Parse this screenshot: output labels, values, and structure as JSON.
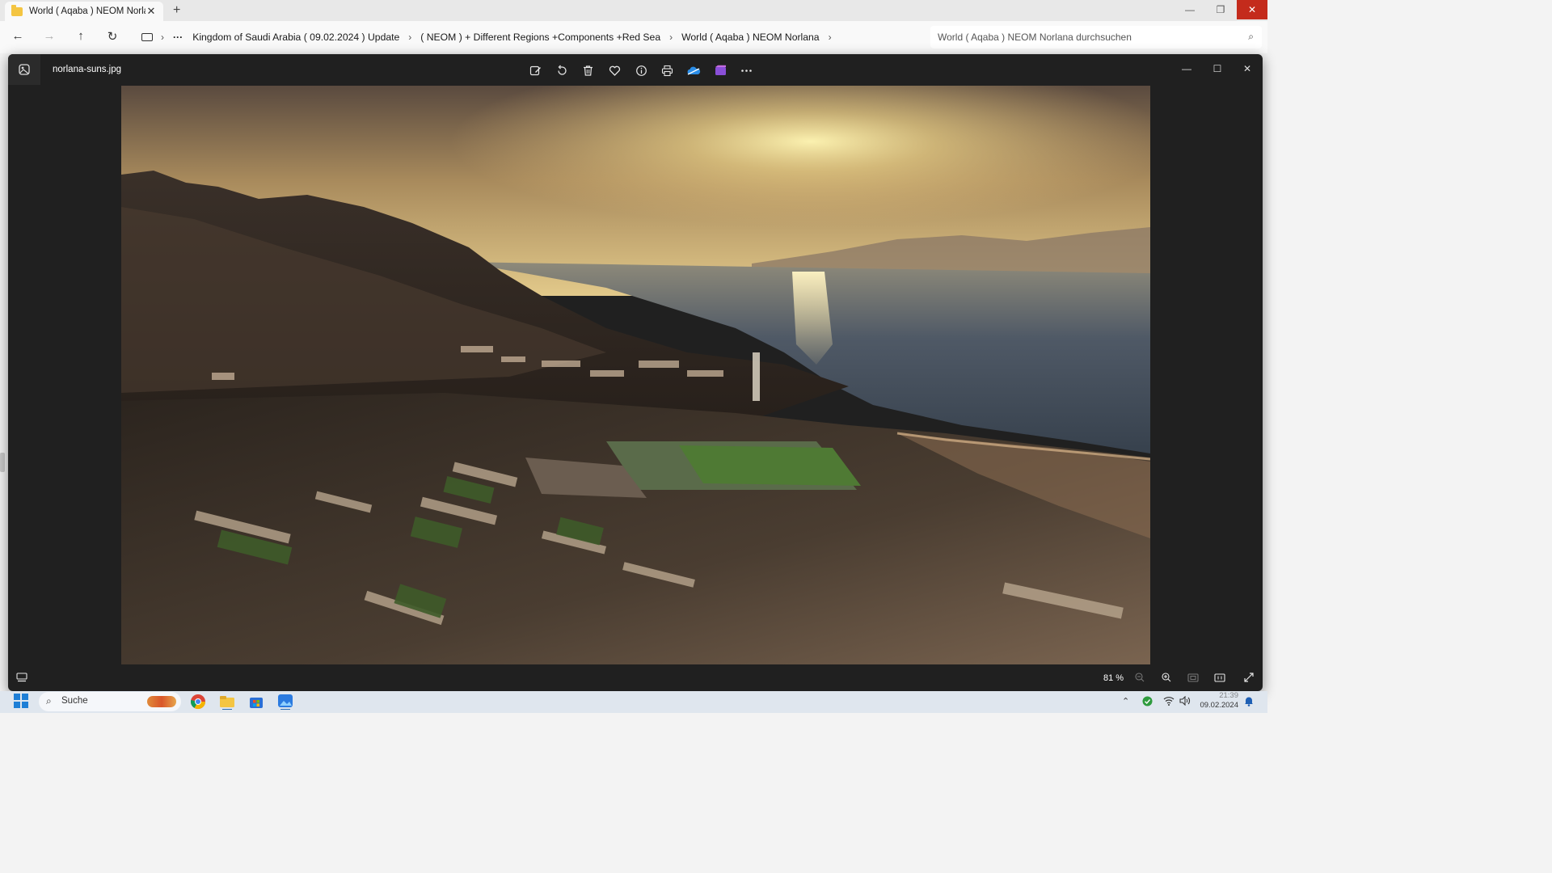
{
  "explorer": {
    "tab_title": "World ( Aqaba ) NEOM Norlan",
    "new_tab_label": "+",
    "breadcrumb": {
      "items": [
        "Kingdom of Saudi Arabia ( 09.02.2024 ) Update",
        "( NEOM ) + Different Regions +Components +Red Sea",
        "World ( Aqaba ) NEOM Norlana"
      ],
      "overflow": "···"
    },
    "search_placeholder": "World ( Aqaba ) NEOM Norlana durchsuchen"
  },
  "viewer": {
    "filename": "norlana-suns.jpg",
    "zoom_label": "81 %",
    "toolbar_icons": [
      "edit-icon",
      "rotate-icon",
      "delete-icon",
      "favorite-icon",
      "info-icon",
      "print-icon",
      "onedrive-icon",
      "clipchamp-icon",
      "more-icon"
    ],
    "image_description_colors": {
      "sky_top": "#5a4a3e",
      "sun": "#f6e49a",
      "sea": "#3f4d5c"
    }
  },
  "taskbar": {
    "search_label": "Suche",
    "time": "21:39",
    "date": "09.02.2024"
  }
}
